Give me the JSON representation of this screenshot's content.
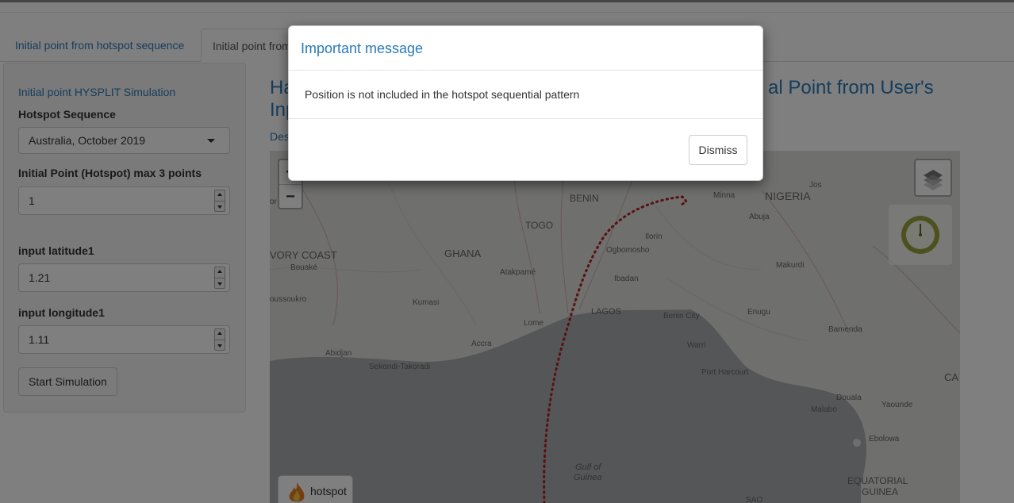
{
  "tabs": [
    {
      "label": "Initial point from hotspot sequence"
    },
    {
      "label": "Initial point from User's Input"
    }
  ],
  "sidebar": {
    "title": "Initial point HYSPLIT Simulation",
    "hotspot_label": "Hotspot Sequence",
    "hotspot_value": "Australia, October 2019",
    "points_label": "Initial Point (Hotspot) max 3 points",
    "points_value": "1",
    "lat_label": "input latitude1",
    "lat_value": "1.21",
    "lon_label": "input longitude1",
    "lon_value": "1.11",
    "start_label": "Start Simulation"
  },
  "main": {
    "title_line1_start": "Ha",
    "title_line1_end": "al Point from User's",
    "title_line2_start": "Inp",
    "desc_start": "Des"
  },
  "map": {
    "zoom_in": "+",
    "zoom_out": "−",
    "legend_label": "hotspot",
    "labels": {
      "benin": "BENIN",
      "nigeria": "NIGERIA",
      "togo": "TOGO",
      "ghana": "GHANA",
      "ivory": "VORY COAST",
      "bouake": "Bouaké",
      "atakpame": "Atakpamé",
      "kumasi": "Kumasi",
      "oussoukro": "oussoukro",
      "lome": "Lome",
      "accra": "Accra",
      "abidjan": "Abidjan",
      "sekondi": "Sekondi-Takoradi",
      "ilorin": "Ilorin",
      "ogbomosho": "Ogbomosho",
      "ibadan": "Ibadan",
      "lagos": "LAGOS",
      "benincity": "Benin City",
      "warri": "Warri",
      "porthar": "Port Harcourt",
      "enugu": "Enugu",
      "makurdi": "Makurdi",
      "bamenda": "Bamenda",
      "abuja": "Abuja",
      "minna": "Minna",
      "jos": "Jos",
      "douala": "Douala",
      "malabo": "Malabo",
      "yaounde": "Yaounde",
      "ebolowa": "Ebolowa",
      "gulf1": "Gulf of",
      "gulf2": "Guinea",
      "eq1": "EQUATORIAL",
      "eq2": "GUINEA",
      "sao": "SAO",
      "ca": "CA",
      "or": "or"
    }
  },
  "modal": {
    "title": "Important message",
    "body": "Position is not included in the hotspot sequential pattern",
    "dismiss": "Dismiss"
  },
  "colors": {
    "accent": "#2a7ab8",
    "trajectory": "#b22222",
    "sea": "#a8acae"
  }
}
